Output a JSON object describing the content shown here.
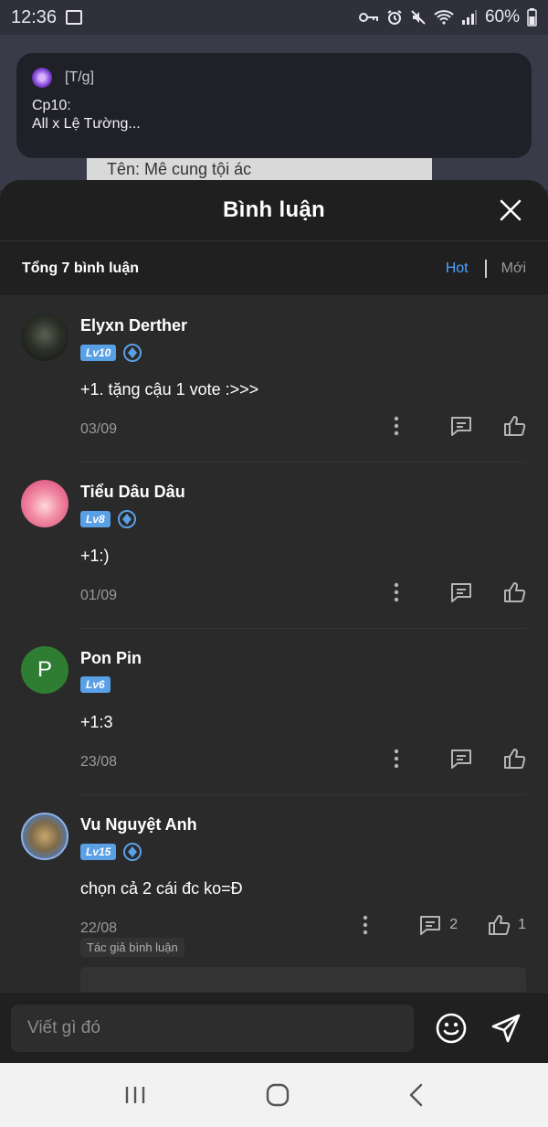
{
  "status_bar": {
    "time": "12:36",
    "battery": "60%"
  },
  "background_card": {
    "text": "Tên: Mê cung tội ác"
  },
  "notification": {
    "app_label": "[T/g]",
    "line1": "Cp10:",
    "line2": "All x Lệ Tường..."
  },
  "sheet": {
    "title": "Bình luận"
  },
  "tabs": {
    "total": "Tổng 7 bình luận",
    "hot": "Hot",
    "new": "Mới"
  },
  "comments": [
    {
      "name": "Elyxn Derther",
      "level": "Lv10",
      "text": "+1. tặng cậu 1 vote :>>>",
      "date": "03/09"
    },
    {
      "name": "Tiểu Dâu Dâu",
      "level": "Lv8",
      "text": "+1:)",
      "date": "01/09"
    },
    {
      "name": "Pon Pin",
      "level": "Lv6",
      "avatar_letter": "P",
      "text": "+1:3",
      "date": "23/08"
    },
    {
      "name": "Vu Nguyệt Anh",
      "level": "Lv15",
      "text": "chọn cả 2 cái đc ko=Đ",
      "date": "22/08",
      "reply_count": "2",
      "like_count": "1",
      "author_tag": "Tác giả bình luận"
    }
  ],
  "composer": {
    "placeholder": "Viết gì đó"
  },
  "colors": {
    "accent": "#4da3ff",
    "level_badge": "#5aa0e6",
    "sheet_bg": "#1f1f1f",
    "list_bg": "#2a2a2a"
  }
}
